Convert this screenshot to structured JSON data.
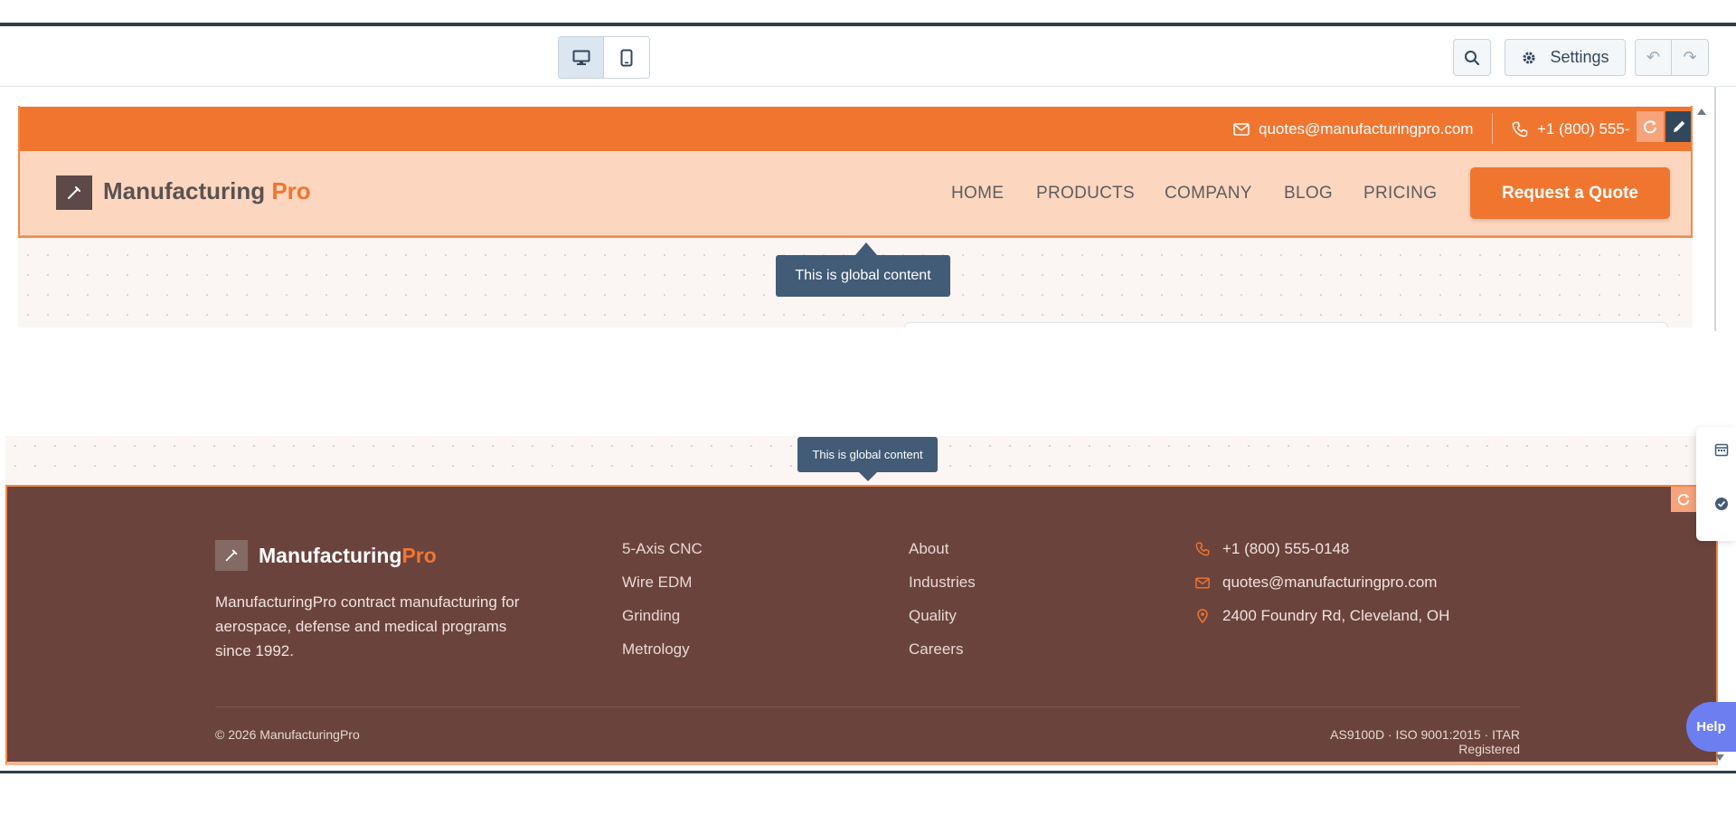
{
  "editor": {
    "settings_label": "Settings",
    "view_modes": [
      "desktop-view",
      "mobile-view"
    ],
    "active_view": "desktop-view"
  },
  "header": {
    "email": "quotes@manufacturingpro.com",
    "phone": "+1 (800) 555-",
    "logo_main": "Manufacturing",
    "logo_accent": "Pro",
    "nav": [
      "HOME",
      "PRODUCTS",
      "COMPANY",
      "BLOG",
      "PRICING"
    ],
    "cta_label": "Request a Quote"
  },
  "tooltips": {
    "top": "This is global content",
    "bottom": "This is global content"
  },
  "footer": {
    "logo_main": "Manufacturing",
    "logo_accent": "Pro",
    "description": "ManufacturingPro contract manufacturing for aerospace, defense and medical programs since 1992.",
    "col1": [
      "5-Axis CNC",
      "Wire EDM",
      "Grinding",
      "Metrology"
    ],
    "col2": [
      "About",
      "Industries",
      "Quality",
      "Careers"
    ],
    "contact": {
      "phone": "+1 (800) 555-0148",
      "email": "quotes@manufacturingpro.com",
      "address": "2400 Foundry Rd, Cleveland, OH"
    },
    "copyright": "© 2026 ManufacturingPro",
    "certifications": "AS9100D · ISO 9001:2015 · ITAR Registered"
  },
  "help_label": "Help",
  "colors": {
    "brand_orange": "#f07630",
    "header_peach": "#fdd6c0",
    "footer_brown": "#6b433d",
    "editor_tooltip": "#425b76",
    "help_purple": "#6c7ef0"
  }
}
